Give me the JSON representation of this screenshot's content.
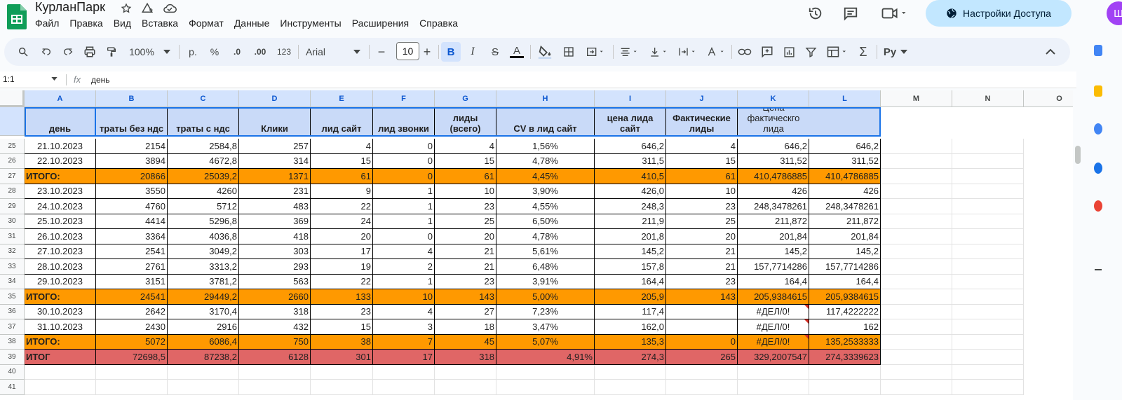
{
  "doc": {
    "title": "КурланПарк"
  },
  "menu": [
    "Файл",
    "Правка",
    "Вид",
    "Вставка",
    "Формат",
    "Данные",
    "Инструменты",
    "Расширения",
    "Справка"
  ],
  "share": {
    "label": "Настройки Доступа"
  },
  "avatar": {
    "initial": "Ш",
    "color": "#a142f4"
  },
  "toolbar": {
    "zoom": "100%",
    "currency": "р.",
    "percent": "%",
    "dec_decrease": ".0",
    "dec_increase": ".00",
    "number_format": "123",
    "font": "Arial",
    "font_size": "10"
  },
  "formula_bar": {
    "cell_ref": "1:1",
    "fx": "fx",
    "value": "день"
  },
  "columns": [
    "A",
    "B",
    "C",
    "D",
    "E",
    "F",
    "G",
    "H",
    "I",
    "J",
    "K",
    "L",
    "M",
    "N",
    "O"
  ],
  "header_row": {
    "row_num": "1",
    "cells": [
      "день",
      "траты без ндс",
      "траты с ндс",
      "Клики",
      "лид сайт",
      "лид звонки",
      "лиды (всего)",
      "CV в лид сайт",
      "цена лида сайт",
      "Фактические лиды",
      "Цена фактическго лида",
      ""
    ]
  },
  "rows": [
    {
      "num": "25",
      "style": "normal",
      "cells": [
        "21.10.2023",
        "2154",
        "2584,8",
        "257",
        "4",
        "0",
        "4",
        "1,56%",
        "646,2",
        "4",
        "646,2",
        "646,2"
      ]
    },
    {
      "num": "26",
      "style": "normal",
      "cells": [
        "22.10.2023",
        "3894",
        "4672,8",
        "314",
        "15",
        "0",
        "15",
        "4,78%",
        "311,5",
        "15",
        "311,52",
        "311,52"
      ]
    },
    {
      "num": "27",
      "style": "itogo",
      "cells": [
        "ИТОГО:",
        "20866",
        "25039,2",
        "1371",
        "61",
        "0",
        "61",
        "4,45%",
        "410,5",
        "61",
        "410,4786885",
        "410,4786885"
      ]
    },
    {
      "num": "28",
      "style": "normal",
      "cells": [
        "23.10.2023",
        "3550",
        "4260",
        "231",
        "9",
        "1",
        "10",
        "3,90%",
        "426,0",
        "10",
        "426",
        "426"
      ]
    },
    {
      "num": "29",
      "style": "normal",
      "cells": [
        "24.10.2023",
        "4760",
        "5712",
        "483",
        "22",
        "1",
        "23",
        "4,55%",
        "248,3",
        "23",
        "248,3478261",
        "248,3478261"
      ]
    },
    {
      "num": "30",
      "style": "normal",
      "cells": [
        "25.10.2023",
        "4414",
        "5296,8",
        "369",
        "24",
        "1",
        "25",
        "6,50%",
        "211,9",
        "25",
        "211,872",
        "211,872"
      ]
    },
    {
      "num": "31",
      "style": "normal",
      "cells": [
        "26.10.2023",
        "3364",
        "4036,8",
        "418",
        "20",
        "0",
        "20",
        "4,78%",
        "201,8",
        "20",
        "201,84",
        "201,84"
      ]
    },
    {
      "num": "32",
      "style": "normal",
      "cells": [
        "27.10.2023",
        "2541",
        "3049,2",
        "303",
        "17",
        "4",
        "21",
        "5,61%",
        "145,2",
        "21",
        "145,2",
        "145,2"
      ]
    },
    {
      "num": "33",
      "style": "normal",
      "cells": [
        "28.10.2023",
        "2761",
        "3313,2",
        "293",
        "19",
        "2",
        "21",
        "6,48%",
        "157,8",
        "21",
        "157,7714286",
        "157,7714286"
      ]
    },
    {
      "num": "34",
      "style": "normal",
      "cells": [
        "29.10.2023",
        "3151",
        "3781,2",
        "563",
        "22",
        "1",
        "23",
        "3,91%",
        "164,4",
        "23",
        "164,4",
        "164,4"
      ]
    },
    {
      "num": "35",
      "style": "itogo",
      "cells": [
        "ИТОГО:",
        "24541",
        "29449,2",
        "2660",
        "133",
        "10",
        "143",
        "5,00%",
        "205,9",
        "143",
        "205,9384615",
        "205,9384615"
      ]
    },
    {
      "num": "36",
      "style": "normal",
      "cells": [
        "30.10.2023",
        "2642",
        "3170,4",
        "318",
        "23",
        "4",
        "27",
        "7,23%",
        "117,4",
        "",
        "#ДЕЛ/0!",
        "117,4222222"
      ]
    },
    {
      "num": "37",
      "style": "normal",
      "cells": [
        "31.10.2023",
        "2430",
        "2916",
        "432",
        "15",
        "3",
        "18",
        "3,47%",
        "162,0",
        "",
        "#ДЕЛ/0!",
        "162"
      ]
    },
    {
      "num": "38",
      "style": "itogo",
      "cells": [
        "ИТОГО:",
        "5072",
        "6086,4",
        "750",
        "38",
        "7",
        "45",
        "5,07%",
        "135,3",
        "0",
        "#ДЕЛ/0!",
        "135,2533333"
      ]
    },
    {
      "num": "39",
      "style": "itog",
      "cells": [
        "ИТОГ",
        "72698,5",
        "87238,2",
        "6128",
        "301",
        "17",
        "318",
        "4,91%",
        "274,3",
        "265",
        "329,2007547",
        "274,3339623"
      ]
    },
    {
      "num": "40",
      "style": "empty",
      "cells": []
    },
    {
      "num": "41",
      "style": "empty",
      "cells": []
    }
  ],
  "colors": {
    "header_fill": "#c9daf8",
    "itogo_fill": "#ff9900",
    "itog_fill": "#e06666",
    "selection": "#1a73e8"
  }
}
